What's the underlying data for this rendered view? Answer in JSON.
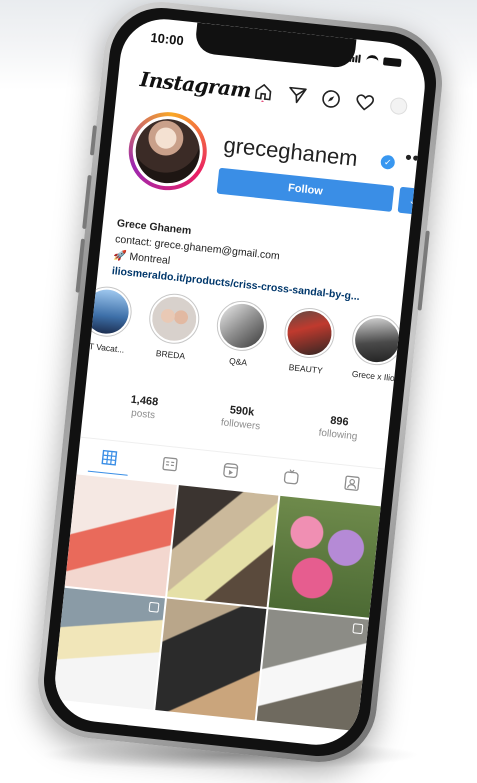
{
  "status_bar": {
    "time": "10:00"
  },
  "app": {
    "name": "Instagram"
  },
  "profile": {
    "username": "greceghanem",
    "verified": true,
    "follow_label": "Follow",
    "dropdown_label": "⌄",
    "more_label": "•••",
    "bio": {
      "name": "Grece Ghanem",
      "contact": "contact: grece.ghanem@gmail.com",
      "location": "Montreal",
      "link": "iliosmeraldo.it/products/criss-cross-sandal-by-g..."
    }
  },
  "highlights": [
    {
      "label": "FIT Vacat..."
    },
    {
      "label": "BREDA"
    },
    {
      "label": "Q&A"
    },
    {
      "label": "BEAUTY"
    },
    {
      "label": "Grece x Ilio"
    },
    {
      "label": ""
    }
  ],
  "stats": {
    "posts": {
      "count": "1,468",
      "label": "posts"
    },
    "followers": {
      "count": "590k",
      "label": "followers"
    },
    "following": {
      "count": "896",
      "label": "following"
    }
  },
  "tabs": [
    {
      "icon": "grid-icon",
      "active": true
    },
    {
      "icon": "guide-icon",
      "active": false
    },
    {
      "icon": "reels-icon",
      "active": false
    },
    {
      "icon": "igtv-icon",
      "active": false
    },
    {
      "icon": "tagged-icon",
      "active": false
    }
  ],
  "colors": {
    "accent": "#3a8ee6",
    "link": "#00376b",
    "muted": "#8e8e8e",
    "verified": "#3897f0"
  }
}
